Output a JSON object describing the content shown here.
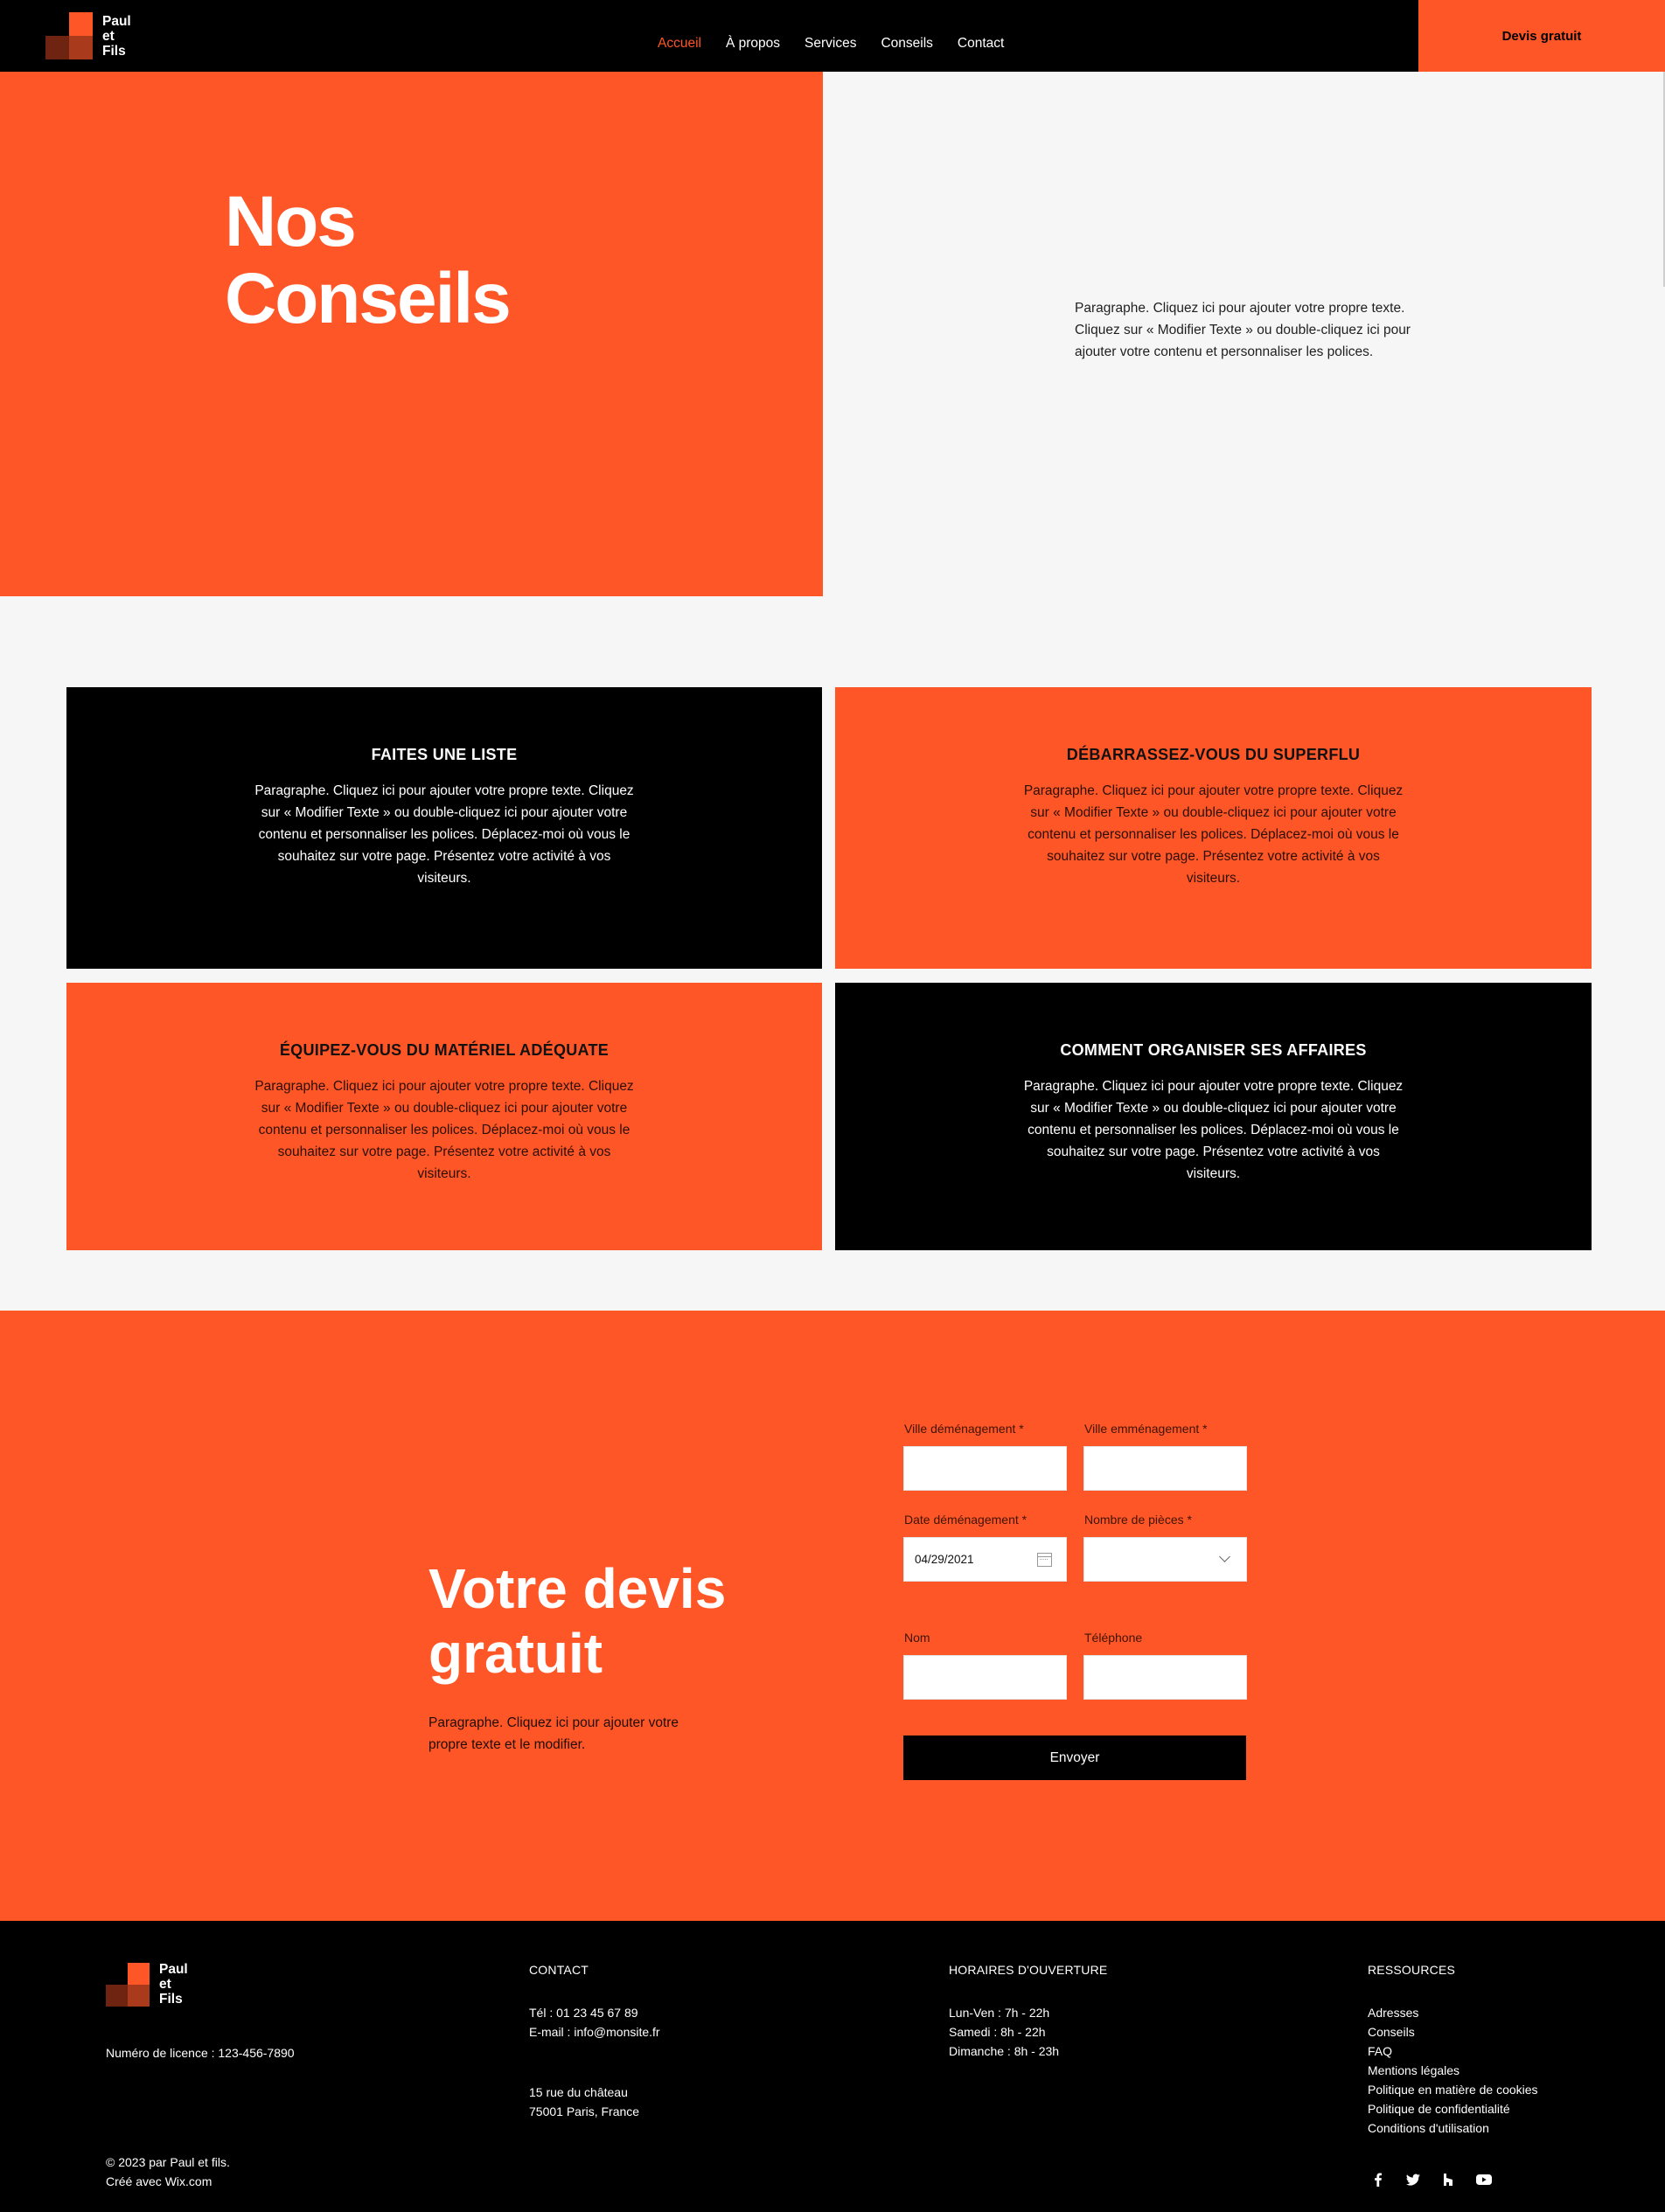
{
  "brand": {
    "name": "Paul\net\nFils",
    "accent": "#ff5627",
    "dark": "#000000"
  },
  "nav": {
    "items": [
      {
        "label": "Accueil",
        "active": true
      },
      {
        "label": "À propos"
      },
      {
        "label": "Services"
      },
      {
        "label": "Conseils"
      },
      {
        "label": "Contact"
      }
    ],
    "cta": "Devis gratuit"
  },
  "hero": {
    "title": "Nos\nConseils",
    "paragraph": "Paragraphe. Cliquez ici pour ajouter votre propre texte. Cliquez sur  « Modifier Texte » ou double-cliquez ici pour ajouter votre contenu et personnaliser les polices."
  },
  "tips": [
    {
      "title": "FAITES UNE LISTE",
      "text": "Paragraphe. Cliquez ici pour ajouter votre propre texte. Cliquez sur « Modifier Texte » ou double-cliquez ici pour ajouter votre contenu et personnaliser les polices. Déplacez-moi où vous le souhaitez sur votre page. Présentez votre activité à vos visiteurs."
    },
    {
      "title": "DÉBARRASSEZ-VOUS DU SUPERFLU",
      "text": "Paragraphe. Cliquez ici pour ajouter votre propre texte. Cliquez sur « Modifier Texte » ou double-cliquez ici pour ajouter votre contenu et personnaliser les polices. Déplacez-moi où vous le souhaitez sur votre page. Présentez votre activité à vos visiteurs."
    },
    {
      "title": "ÉQUIPEZ-VOUS DU MATÉRIEL ADÉQUATE",
      "text": "Paragraphe. Cliquez ici pour ajouter votre propre texte. Cliquez sur « Modifier Texte » ou double-cliquez ici pour ajouter votre contenu et personnaliser les polices. Déplacez-moi où vous le souhaitez sur votre page. Présentez votre activité à vos visiteurs."
    },
    {
      "title": "COMMENT ORGANISER SES AFFAIRES",
      "text": "Paragraphe. Cliquez ici pour ajouter votre propre texte. Cliquez sur « Modifier Texte » ou double-cliquez ici pour ajouter votre contenu et personnaliser les polices. Déplacez-moi où vous le souhaitez sur votre page. Présentez votre activité à vos visiteurs."
    }
  ],
  "quote": {
    "title": "Votre devis\ngratuit",
    "paragraph": "Paragraphe. Cliquez ici pour ajouter votre propre texte et le modifier.",
    "form": {
      "city_from_label": "Ville déménagement *",
      "city_from_value": "",
      "city_to_label": "Ville emménagement *",
      "city_to_value": "",
      "date_label": "Date déménagement *",
      "date_value": "04/29/2021",
      "rooms_label": "Nombre de pièces *",
      "rooms_value": "",
      "name_label": "Nom",
      "name_value": "",
      "phone_label": "Téléphone",
      "phone_value": "",
      "submit": "Envoyer"
    }
  },
  "footer": {
    "license": "Numéro de licence : 123-456-7890",
    "copyright": "© 2023 par Paul et fils.\nCréé avec Wix.com",
    "contact_heading": "CONTACT",
    "contact_lines": "Tél : 01 23 45 67 89\nE-mail : info@monsite.fr",
    "address": "15 rue du château\n75001 Paris, France",
    "hours_heading": "HORAIRES D'OUVERTURE",
    "hours": "Lun-Ven : 7h - 22h\nSamedi : 8h - 22h\nDimanche : 8h - 23h",
    "resources_heading": "RESSOURCES",
    "resources": [
      "Adresses",
      "Conseils",
      "FAQ",
      "Mentions légales",
      "Politique en matière de cookies",
      "Politique de confidentialité",
      "Conditions d'utilisation"
    ],
    "socials": [
      "facebook-icon",
      "twitter-icon",
      "houzz-icon",
      "youtube-icon"
    ]
  }
}
